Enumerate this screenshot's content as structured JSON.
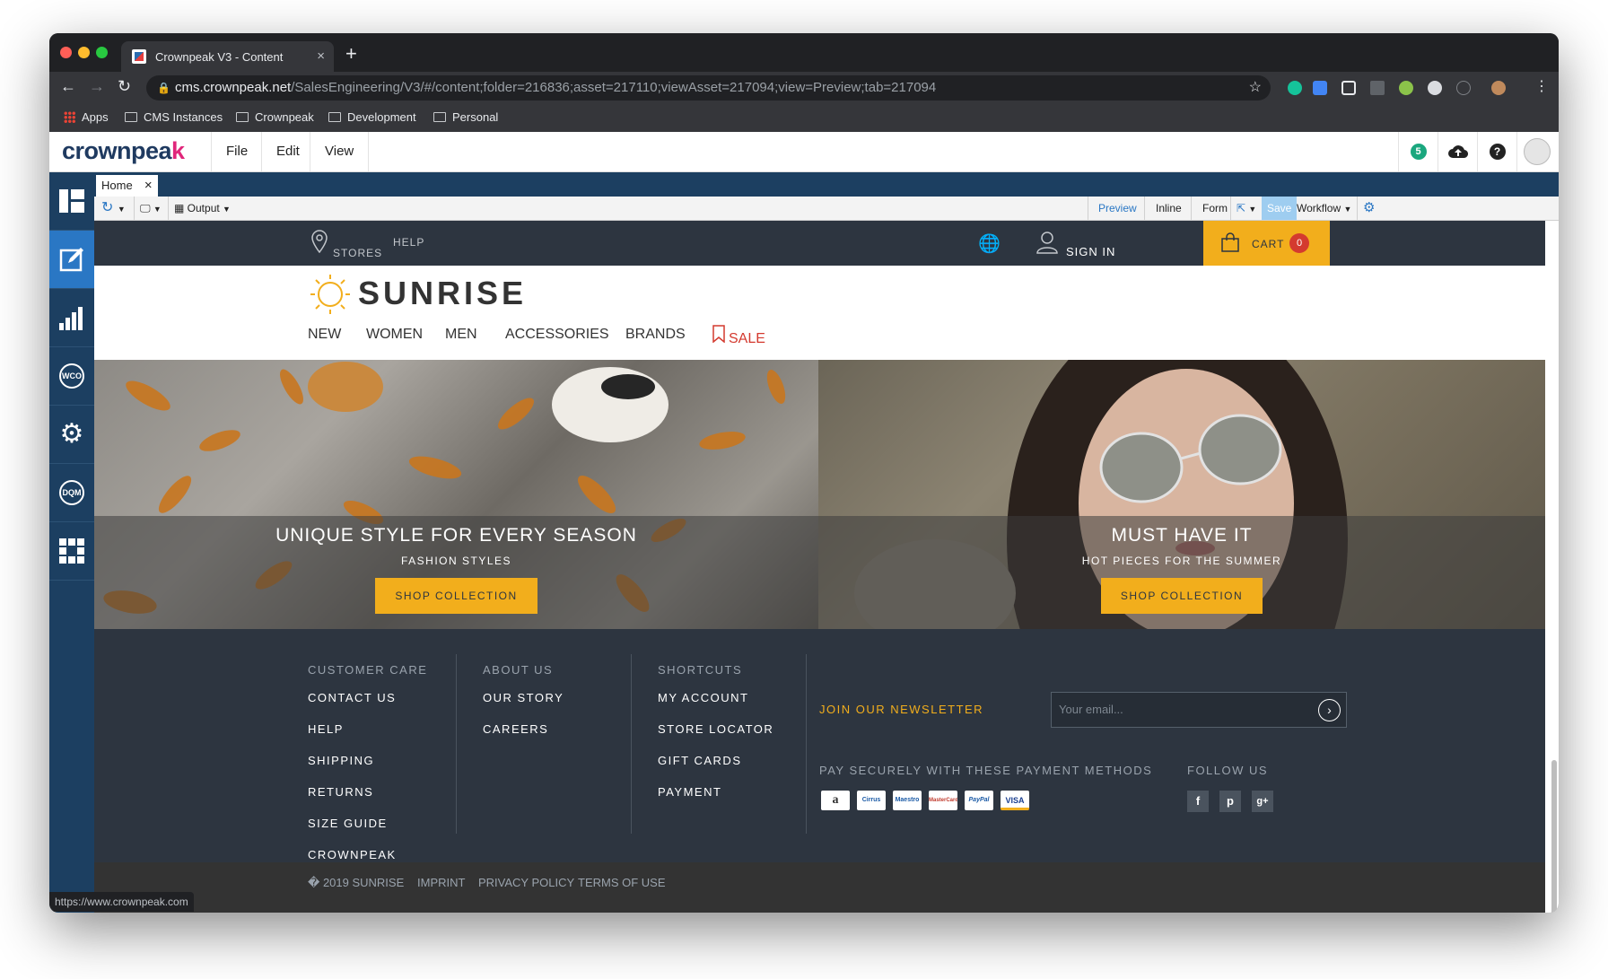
{
  "browser": {
    "tab_title": "Crownpeak V3 - Content",
    "tab_close": "×",
    "new_tab": "+",
    "url_host": "cms.crownpeak.net",
    "url_path": "/SalesEngineering/V3/#/content;folder=216836;asset=217110;viewAsset=217094;view=Preview;tab=217094",
    "bookmarks": [
      "Apps",
      "CMS Instances",
      "Crownpeak",
      "Development",
      "Personal"
    ],
    "status_url": "https://www.crownpeak.com"
  },
  "cms": {
    "logo_text": "crownpea",
    "logo_accent": "k",
    "menus": [
      "File",
      "Edit",
      "View"
    ],
    "notification_count": "5",
    "doc_tab": "Home",
    "doc_tab_close": "×",
    "output_label": "Output",
    "view_modes": [
      "Preview",
      "Inline",
      "Form"
    ],
    "save_label": "Save",
    "workflow_label": "Workflow"
  },
  "site": {
    "top_links": [
      "STORES",
      "HELP"
    ],
    "sign_in": "SIGN IN",
    "cart_label": "CART",
    "cart_count": "0",
    "brand": "SUNRISE",
    "nav": [
      "NEW",
      "WOMEN",
      "MEN",
      "ACCESSORIES",
      "BRANDS"
    ],
    "nav_sale": "SALE",
    "heroes": [
      {
        "title": "UNIQUE STYLE FOR EVERY SEASON",
        "subtitle": "FASHION STYLES",
        "cta": "SHOP COLLECTION"
      },
      {
        "title": "MUST HAVE IT",
        "subtitle": "HOT PIECES FOR THE SUMMER",
        "cta": "SHOP COLLECTION"
      }
    ],
    "footer": {
      "col1_heading": "CUSTOMER CARE",
      "col1_links": [
        "CONTACT US",
        "HELP",
        "SHIPPING",
        "RETURNS",
        "SIZE GUIDE",
        "CROWNPEAK"
      ],
      "col2_heading": "ABOUT US",
      "col2_links": [
        "OUR STORY",
        "CAREERS"
      ],
      "col3_heading": "SHORTCUTS",
      "col3_links": [
        "MY ACCOUNT",
        "STORE LOCATOR",
        "GIFT CARDS",
        "PAYMENT"
      ],
      "newsletter_label": "JOIN OUR NEWSLETTER",
      "newsletter_placeholder": "Your email...",
      "payment_label": "PAY SECURELY WITH THESE PAYMENT METHODS",
      "payment_methods": [
        "a",
        "Cirrus",
        "Maestro",
        "MasterCard",
        "PayPal",
        "VISA"
      ],
      "follow_label": "FOLLOW US",
      "social": [
        "f",
        "p",
        "g+"
      ]
    },
    "subfooter": [
      "� 2019 SUNRISE",
      "IMPRINT",
      "PRIVACY POLICY",
      "TERMS OF USE"
    ]
  },
  "colors": {
    "accent": "#f2ae1c",
    "site_dark": "#2d3540",
    "cms_nav": "#1c3f61",
    "cms_active": "#2a77c4",
    "sale_red": "#d43a2f"
  }
}
